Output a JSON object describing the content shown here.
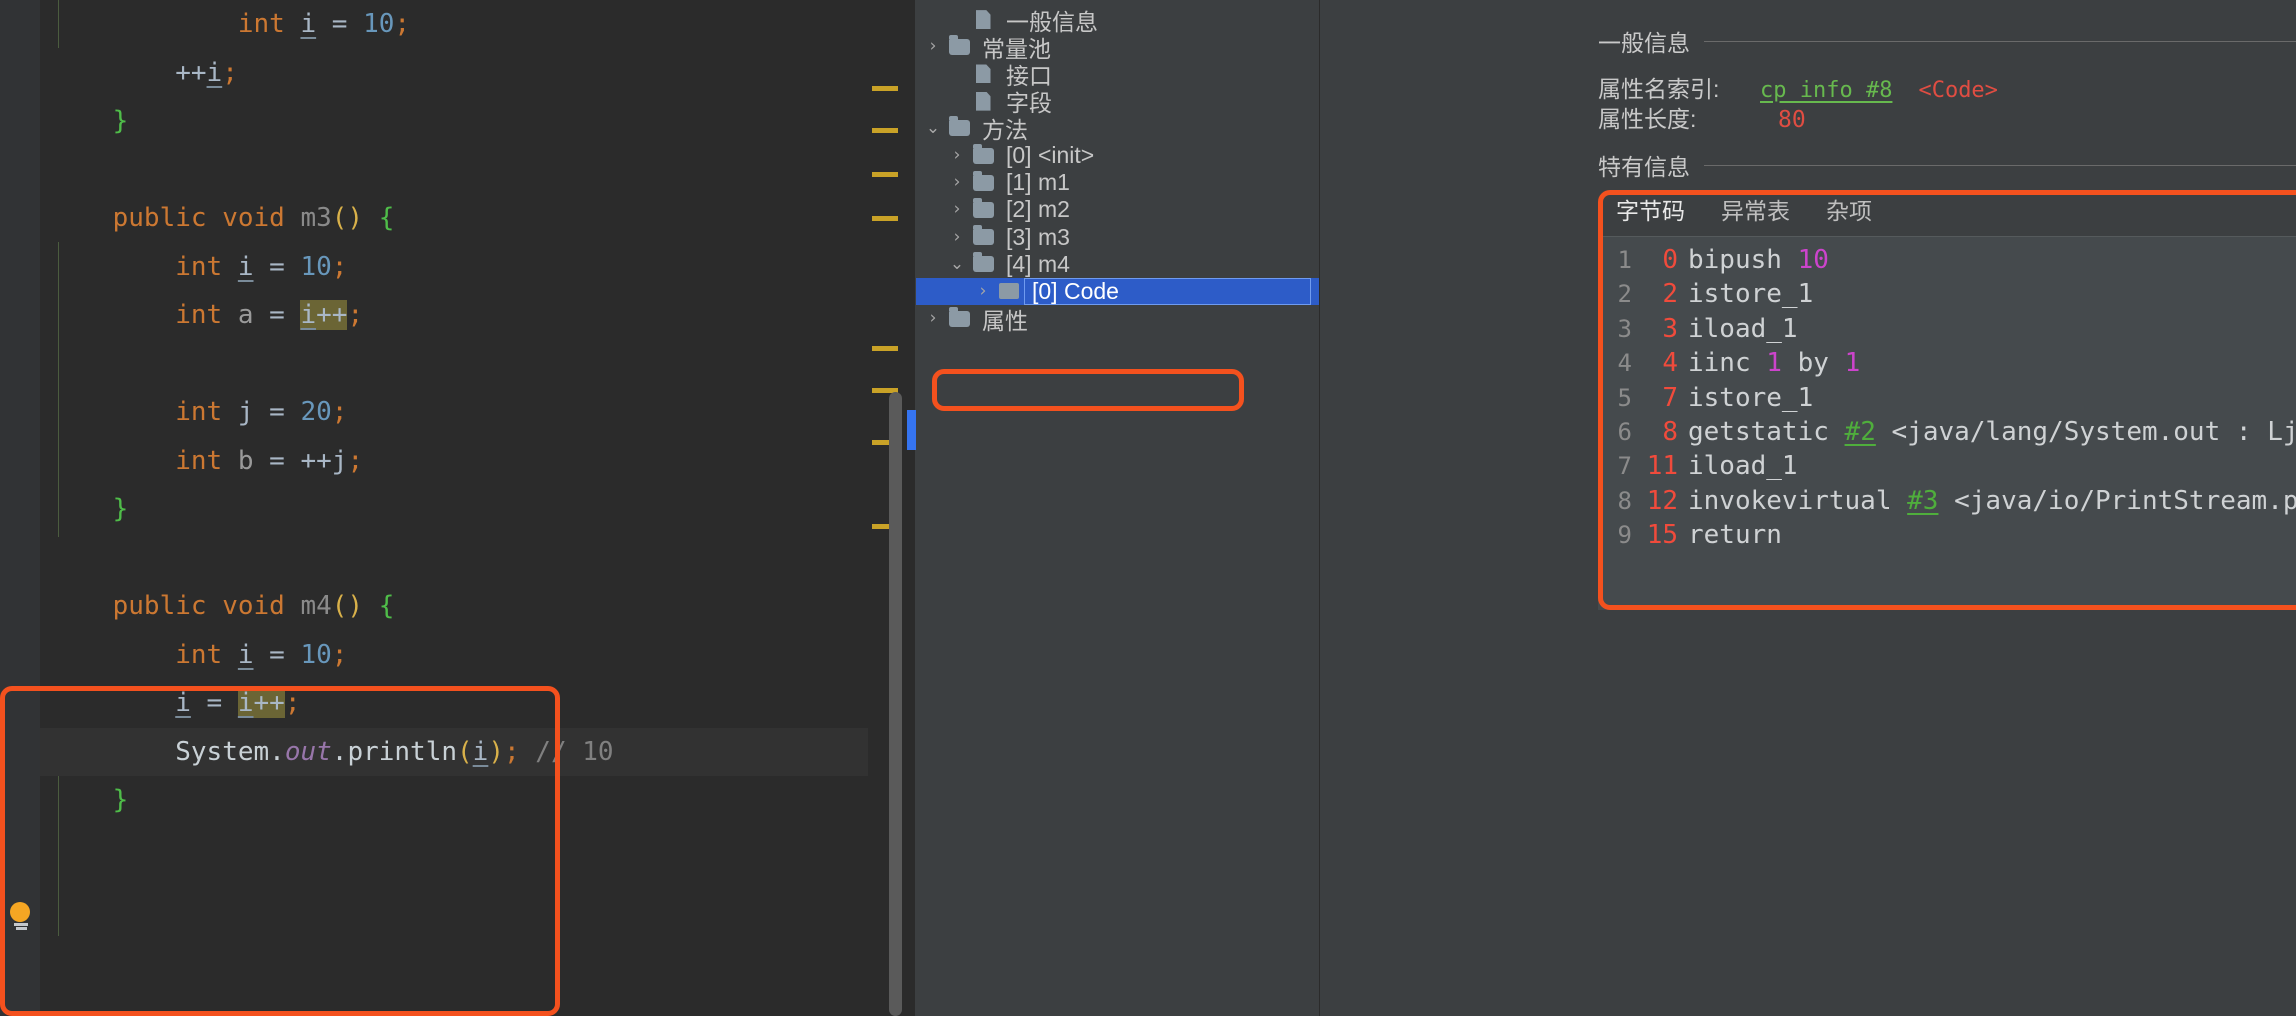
{
  "editor": {
    "lines": [
      {
        "id": "l1",
        "tokens": [
          {
            "t": "            ",
            "c": "plain"
          },
          {
            "t": "int",
            "c": "kw"
          },
          {
            "t": " ",
            "c": "plain"
          },
          {
            "t": "i",
            "c": "var"
          },
          {
            "t": " = ",
            "c": "plain"
          },
          {
            "t": "10",
            "c": "num"
          },
          {
            "t": ";",
            "c": "semi"
          }
        ]
      },
      {
        "id": "l2",
        "tokens": [
          {
            "t": "        ",
            "c": "plain"
          },
          {
            "t": "++",
            "c": "plain"
          },
          {
            "t": "i",
            "c": "var"
          },
          {
            "t": ";",
            "c": "semi"
          }
        ]
      },
      {
        "id": "l3",
        "tokens": [
          {
            "t": "    ",
            "c": "plain"
          },
          {
            "t": "}",
            "c": "brace"
          }
        ]
      },
      {
        "id": "l4",
        "tokens": []
      },
      {
        "id": "l5",
        "tokens": [
          {
            "t": "    ",
            "c": "plain"
          },
          {
            "t": "public void ",
            "c": "kw"
          },
          {
            "t": "m3",
            "c": "meth"
          },
          {
            "t": "()",
            "c": "paren"
          },
          {
            "t": " ",
            "c": "plain"
          },
          {
            "t": "{",
            "c": "brace"
          }
        ]
      },
      {
        "id": "l6",
        "tokens": [
          {
            "t": "        ",
            "c": "plain"
          },
          {
            "t": "int",
            "c": "kw"
          },
          {
            "t": " ",
            "c": "plain"
          },
          {
            "t": "i",
            "c": "var"
          },
          {
            "t": " = ",
            "c": "plain"
          },
          {
            "t": "10",
            "c": "num"
          },
          {
            "t": ";",
            "c": "semi"
          }
        ]
      },
      {
        "id": "l7",
        "tokens": [
          {
            "t": "        ",
            "c": "plain"
          },
          {
            "t": "int",
            "c": "kw"
          },
          {
            "t": " ",
            "c": "plain"
          },
          {
            "t": "a",
            "c": "ident"
          },
          {
            "t": " = ",
            "c": "plain"
          },
          {
            "t": "i",
            "c": "var hlbox"
          },
          {
            "t": "++",
            "c": "plain hlbox"
          },
          {
            "t": ";",
            "c": "semi"
          }
        ]
      },
      {
        "id": "l8",
        "tokens": []
      },
      {
        "id": "l9",
        "tokens": [
          {
            "t": "        ",
            "c": "plain"
          },
          {
            "t": "int",
            "c": "kw"
          },
          {
            "t": " ",
            "c": "plain"
          },
          {
            "t": "j",
            "c": "plain"
          },
          {
            "t": " = ",
            "c": "plain"
          },
          {
            "t": "20",
            "c": "num"
          },
          {
            "t": ";",
            "c": "semi"
          }
        ]
      },
      {
        "id": "l10",
        "tokens": [
          {
            "t": "        ",
            "c": "plain"
          },
          {
            "t": "int",
            "c": "kw"
          },
          {
            "t": " ",
            "c": "plain"
          },
          {
            "t": "b",
            "c": "ident"
          },
          {
            "t": " = ",
            "c": "plain"
          },
          {
            "t": "++",
            "c": "plain"
          },
          {
            "t": "j",
            "c": "plain"
          },
          {
            "t": ";",
            "c": "semi"
          }
        ]
      },
      {
        "id": "l11",
        "tokens": [
          {
            "t": "    ",
            "c": "plain"
          },
          {
            "t": "}",
            "c": "brace"
          }
        ]
      },
      {
        "id": "l12",
        "tokens": []
      },
      {
        "id": "l13",
        "tokens": [
          {
            "t": "    ",
            "c": "plain"
          },
          {
            "t": "public void ",
            "c": "kw"
          },
          {
            "t": "m4",
            "c": "meth"
          },
          {
            "t": "()",
            "c": "paren"
          },
          {
            "t": " ",
            "c": "plain"
          },
          {
            "t": "{",
            "c": "brace"
          }
        ]
      },
      {
        "id": "l14",
        "tokens": [
          {
            "t": "        ",
            "c": "plain"
          },
          {
            "t": "int",
            "c": "kw"
          },
          {
            "t": " ",
            "c": "plain"
          },
          {
            "t": "i",
            "c": "var"
          },
          {
            "t": " = ",
            "c": "plain"
          },
          {
            "t": "10",
            "c": "num"
          },
          {
            "t": ";",
            "c": "semi"
          }
        ]
      },
      {
        "id": "l15",
        "tokens": [
          {
            "t": "        ",
            "c": "plain"
          },
          {
            "t": "i",
            "c": "var"
          },
          {
            "t": " = ",
            "c": "plain"
          },
          {
            "t": "i",
            "c": "var hlbox"
          },
          {
            "t": "++",
            "c": "plain hlbox"
          },
          {
            "t": ";",
            "c": "semi"
          }
        ]
      },
      {
        "id": "l16",
        "highlight": true,
        "tokens": [
          {
            "t": "        ",
            "c": "plain"
          },
          {
            "t": "System",
            "c": "white"
          },
          {
            "t": ".",
            "c": "white"
          },
          {
            "t": "out",
            "c": "field"
          },
          {
            "t": ".",
            "c": "white"
          },
          {
            "t": "println",
            "c": "white"
          },
          {
            "t": "(",
            "c": "paren"
          },
          {
            "t": "i",
            "c": "var"
          },
          {
            "t": ")",
            "c": "paren"
          },
          {
            "t": ";",
            "c": "semi"
          },
          {
            "t": " ",
            "c": "plain"
          },
          {
            "t": "// 10",
            "c": "cmt"
          }
        ]
      },
      {
        "id": "l17",
        "tokens": [
          {
            "t": "    ",
            "c": "plain"
          },
          {
            "t": "}",
            "c": "brace"
          }
        ]
      }
    ],
    "bulb_icon": "lightbulb-icon"
  },
  "tree": {
    "items": [
      {
        "label": "一般信息",
        "icon": "document-icon",
        "arrow": "",
        "indent": 2,
        "selected": false
      },
      {
        "label": "常量池",
        "icon": "folder-icon",
        "arrow": "›",
        "indent": 1,
        "selected": false
      },
      {
        "label": "接口",
        "icon": "document-icon",
        "arrow": "",
        "indent": 2,
        "selected": false
      },
      {
        "label": "字段",
        "icon": "document-icon",
        "arrow": "",
        "indent": 2,
        "selected": false
      },
      {
        "label": "方法",
        "icon": "folder-icon",
        "arrow": "⌄",
        "indent": 1,
        "selected": false
      },
      {
        "label": "[0] <init>",
        "icon": "folder-icon",
        "arrow": "›",
        "indent": 2,
        "selected": false
      },
      {
        "label": "[1] m1",
        "icon": "folder-icon",
        "arrow": "›",
        "indent": 2,
        "selected": false
      },
      {
        "label": "[2] m2",
        "icon": "folder-icon",
        "arrow": "›",
        "indent": 2,
        "selected": false
      },
      {
        "label": "[3] m3",
        "icon": "folder-icon",
        "arrow": "›",
        "indent": 2,
        "selected": false
      },
      {
        "label": "[4] m4",
        "icon": "folder-icon",
        "arrow": "⌄",
        "indent": 2,
        "selected": false,
        "annotated": true
      },
      {
        "label": "[0] Code",
        "icon": "square-icon",
        "arrow": "›",
        "indent": 3,
        "selected": true
      },
      {
        "label": "属性",
        "icon": "folder-icon",
        "arrow": "›",
        "indent": 1,
        "selected": false
      }
    ]
  },
  "detail": {
    "general_section_title": "一般信息",
    "attr_name_index_label": "属性名索引:",
    "attr_name_index_link": "cp_info #8",
    "attr_name_index_value": "<Code>",
    "attr_length_label": "属性长度:",
    "attr_length_value": "80",
    "specific_section_title": "特有信息",
    "tabs": [
      {
        "label": "字节码",
        "active": true
      },
      {
        "label": "异常表",
        "active": false
      },
      {
        "label": "杂项",
        "active": false
      }
    ],
    "bytecode": [
      {
        "line": "1",
        "offset": "0",
        "parts": [
          {
            "t": "bipush ",
            "c": "bcop"
          },
          {
            "t": "10",
            "c": "bcnum"
          }
        ]
      },
      {
        "line": "2",
        "offset": "2",
        "parts": [
          {
            "t": "istore_1",
            "c": "bcop"
          }
        ]
      },
      {
        "line": "3",
        "offset": "3",
        "parts": [
          {
            "t": "iload_1",
            "c": "bcop"
          }
        ]
      },
      {
        "line": "4",
        "offset": "4",
        "parts": [
          {
            "t": "iinc ",
            "c": "bcop"
          },
          {
            "t": "1",
            "c": "bcnum"
          },
          {
            "t": " by ",
            "c": "bcby"
          },
          {
            "t": "1",
            "c": "bcnum"
          }
        ]
      },
      {
        "line": "5",
        "offset": "7",
        "parts": [
          {
            "t": "istore_1",
            "c": "bcop"
          }
        ]
      },
      {
        "line": "6",
        "offset": "8",
        "parts": [
          {
            "t": "getstatic ",
            "c": "bcop"
          },
          {
            "t": "#2",
            "c": "bcref"
          },
          {
            "t": " <java/lang/System.out : Ljava",
            "c": "bcsig"
          }
        ]
      },
      {
        "line": "7",
        "offset": "11",
        "parts": [
          {
            "t": "iload_1",
            "c": "bcop"
          }
        ]
      },
      {
        "line": "8",
        "offset": "12",
        "parts": [
          {
            "t": "invokevirtual ",
            "c": "bcop"
          },
          {
            "t": "#3",
            "c": "bcref"
          },
          {
            "t": " <java/io/PrintStream.pri",
            "c": "bcsig"
          }
        ]
      },
      {
        "line": "9",
        "offset": "15",
        "parts": [
          {
            "t": "return",
            "c": "bcop"
          }
        ]
      }
    ]
  },
  "colors": {
    "annotation_red": "#f4511e",
    "selection_blue": "#2d5cc8",
    "editor_bg": "#2b2b2b",
    "panel_bg": "#3c3f41",
    "bytecode_bg": "#454a4d"
  }
}
